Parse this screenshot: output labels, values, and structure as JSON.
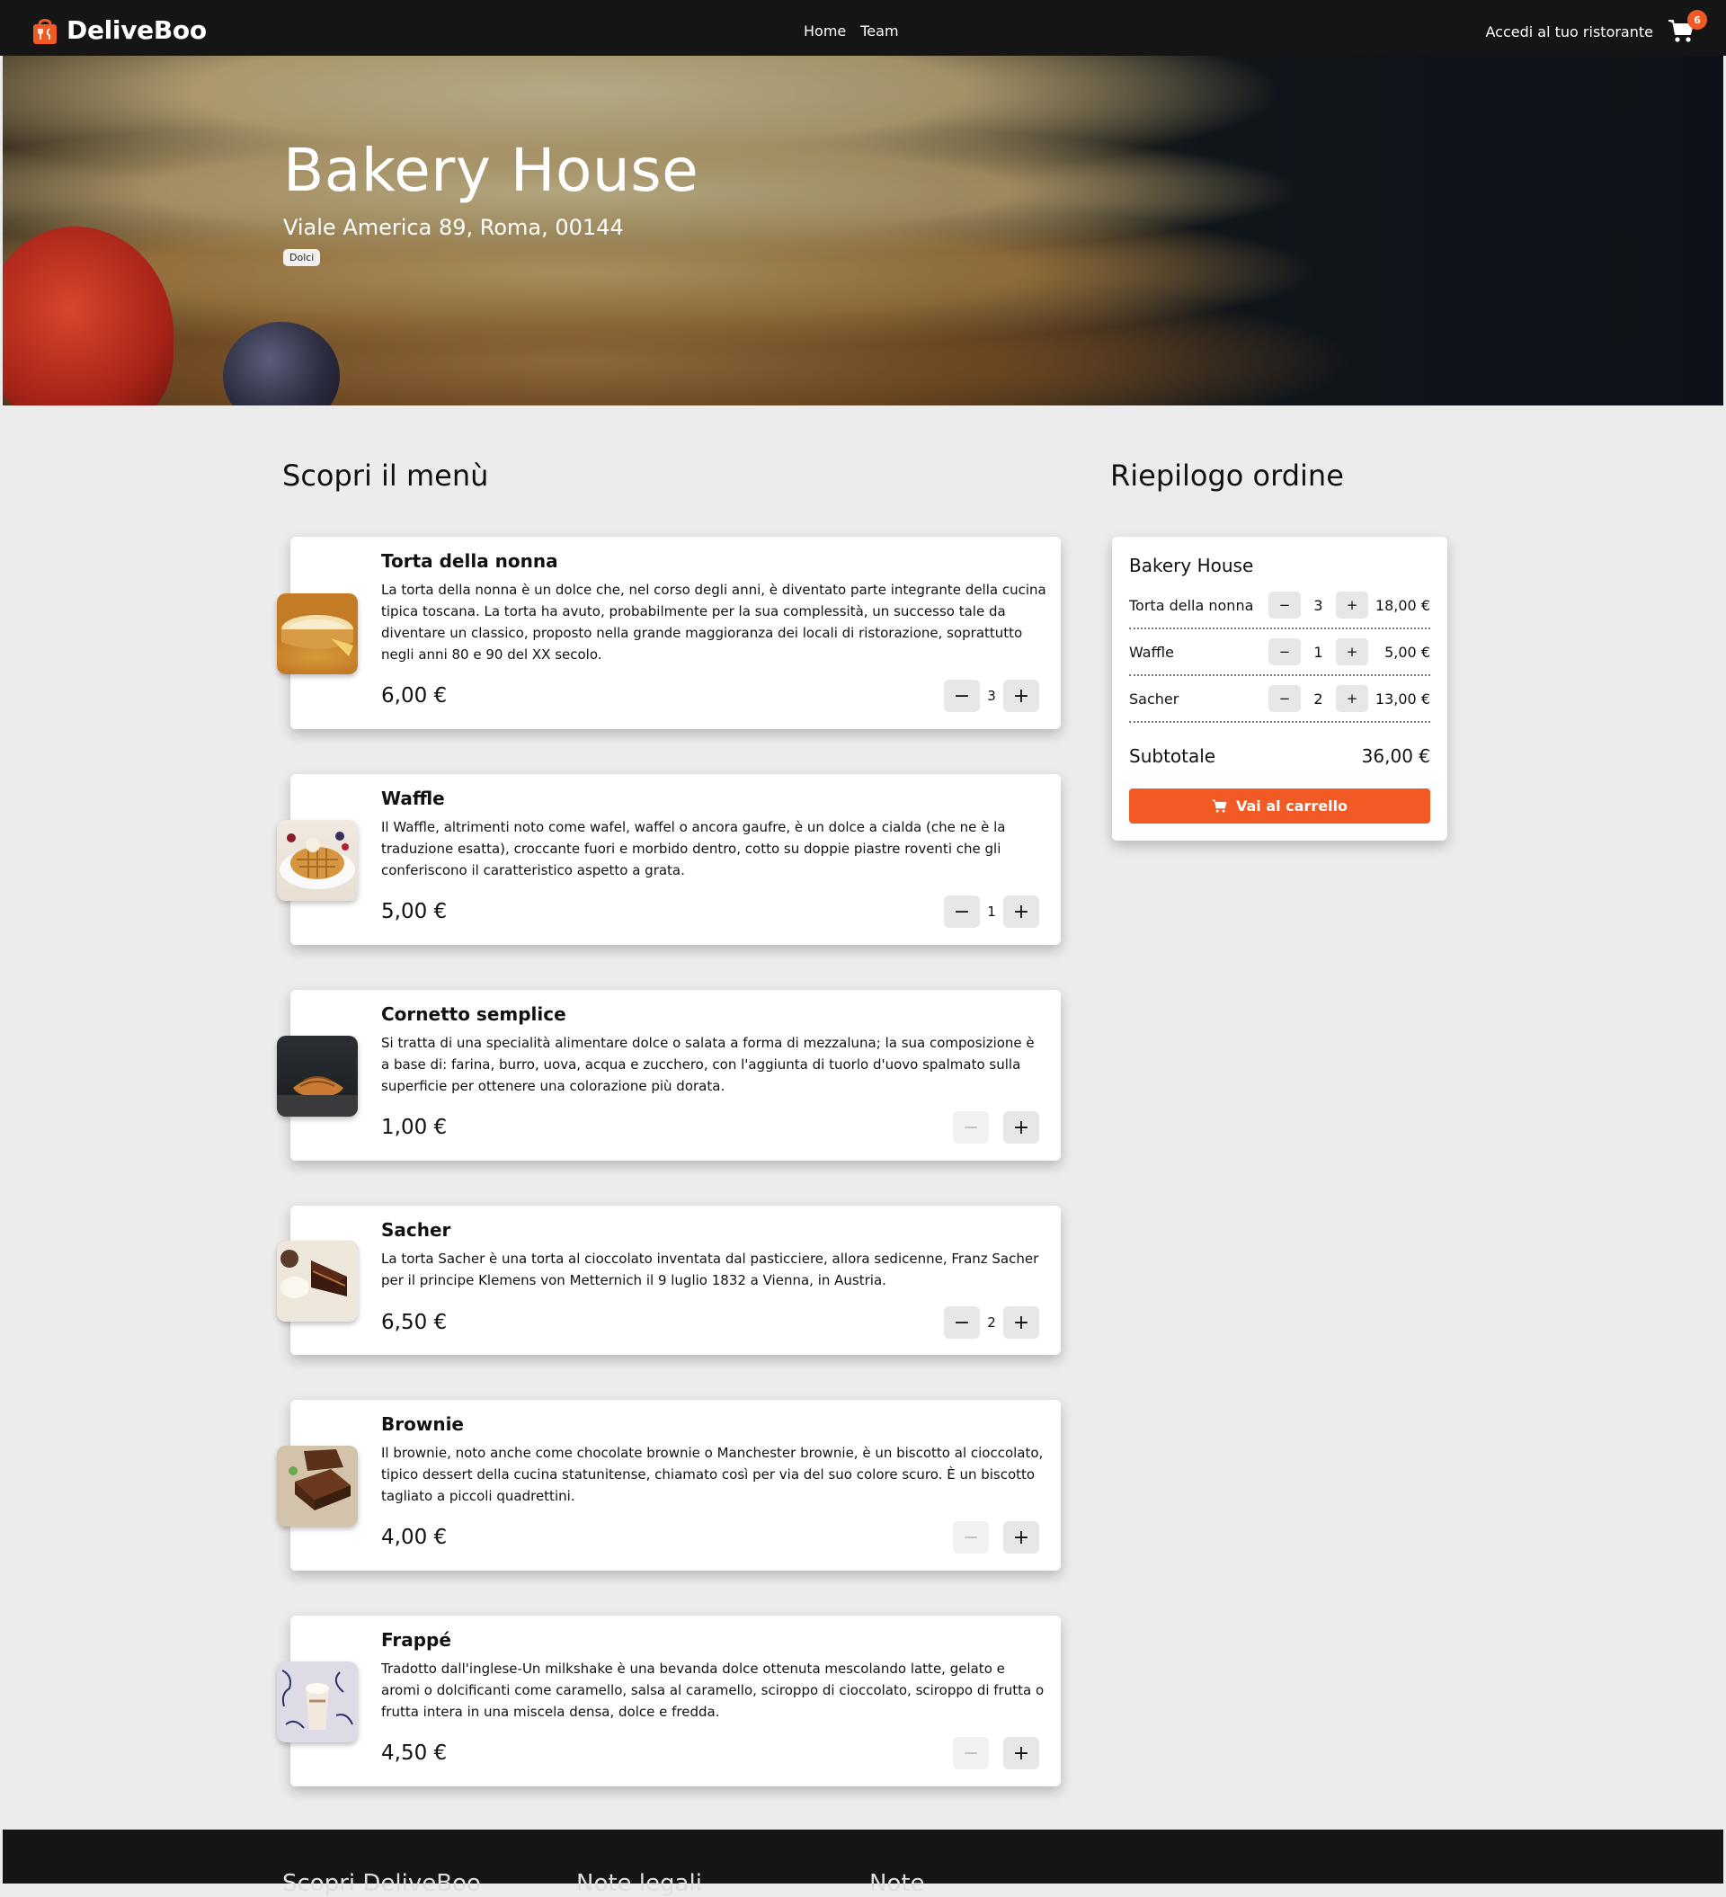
{
  "nav": {
    "brand": "DeliveBoo",
    "links": [
      "Home",
      "Team"
    ],
    "login": "Accedi al tuo ristorante",
    "cart_count": "6",
    "accent": "#f05a24"
  },
  "hero": {
    "title": "Bakery House",
    "address": "Viale America 89, Roma, 00144",
    "tag": "Dolci"
  },
  "menu": {
    "title": "Scopri il menù",
    "items": [
      {
        "name": "Torta della nonna",
        "desc": "La torta della nonna è un dolce che, nel corso degli anni, è diventato parte integrante della cucina tipica toscana. La torta ha avuto, probabilmente per la sua complessità, un successo tale da diventare un classico, proposto nella grande maggioranza dei locali di ristorazione, soprattutto negli anni 80 e 90 del XX secolo.",
        "price": "6,00 €",
        "qty": "3",
        "icon": "tart-image"
      },
      {
        "name": "Waffle",
        "desc": "Il Waffle, altrimenti noto come wafel, waffel o ancora gaufre, è un dolce a cialda (che ne è la traduzione esatta), croccante fuori e morbido dentro, cotto su doppie piastre roventi che gli conferiscono il caratteristico aspetto a grata.",
        "price": "5,00 €",
        "qty": "1",
        "icon": "waffle-image"
      },
      {
        "name": "Cornetto semplice",
        "desc": "Si tratta di una specialità alimentare dolce o salata a forma di mezzaluna; la sua composizione è a base di: farina, burro, uova, acqua e zucchero, con l'aggiunta di tuorlo d'uovo spalmato sulla superficie per ottenere una colorazione più dorata.",
        "price": "1,00 €",
        "qty": "",
        "icon": "croissant-image"
      },
      {
        "name": "Sacher",
        "desc": "La torta Sacher è una torta al cioccolato inventata dal pasticciere, allora sedicenne, Franz Sacher per il principe Klemens von Metternich il 9 luglio 1832 a Vienna, in Austria.",
        "price": "6,50 €",
        "qty": "2",
        "icon": "sacher-image"
      },
      {
        "name": "Brownie",
        "desc": "Il brownie, noto anche come chocolate brownie o Manchester brownie, è un biscotto al cioccolato, tipico dessert della cucina statunitense, chiamato così per via del suo colore scuro. È un biscotto tagliato a piccoli quadrettini.",
        "price": "4,00 €",
        "qty": "",
        "icon": "brownie-image"
      },
      {
        "name": "Frappé",
        "desc": "Tradotto dall'inglese-Un milkshake è una bevanda dolce ottenuta mescolando latte, gelato e aromi o dolcificanti come caramello, salsa al caramello, sciroppo di cioccolato, sciroppo di frutta o frutta intera in una miscela densa, dolce e fredda.",
        "price": "4,50 €",
        "qty": "",
        "icon": "frappe-image"
      }
    ]
  },
  "summary": {
    "title": "Riepilogo ordine",
    "restaurant": "Bakery House",
    "rows": [
      {
        "name": "Torta della nonna",
        "qty": "3",
        "price": "18,00 €"
      },
      {
        "name": "Waffle",
        "qty": "1",
        "price": "5,00 €"
      },
      {
        "name": "Sacher",
        "qty": "2",
        "price": "13,00 €"
      }
    ],
    "subtotal_label": "Subtotale",
    "subtotal_value": "36,00 €",
    "checkout_label": "Vai al carrello"
  },
  "footer": {
    "cols": [
      "Scopri DeliveBoo",
      "Note legali",
      "Note"
    ]
  }
}
